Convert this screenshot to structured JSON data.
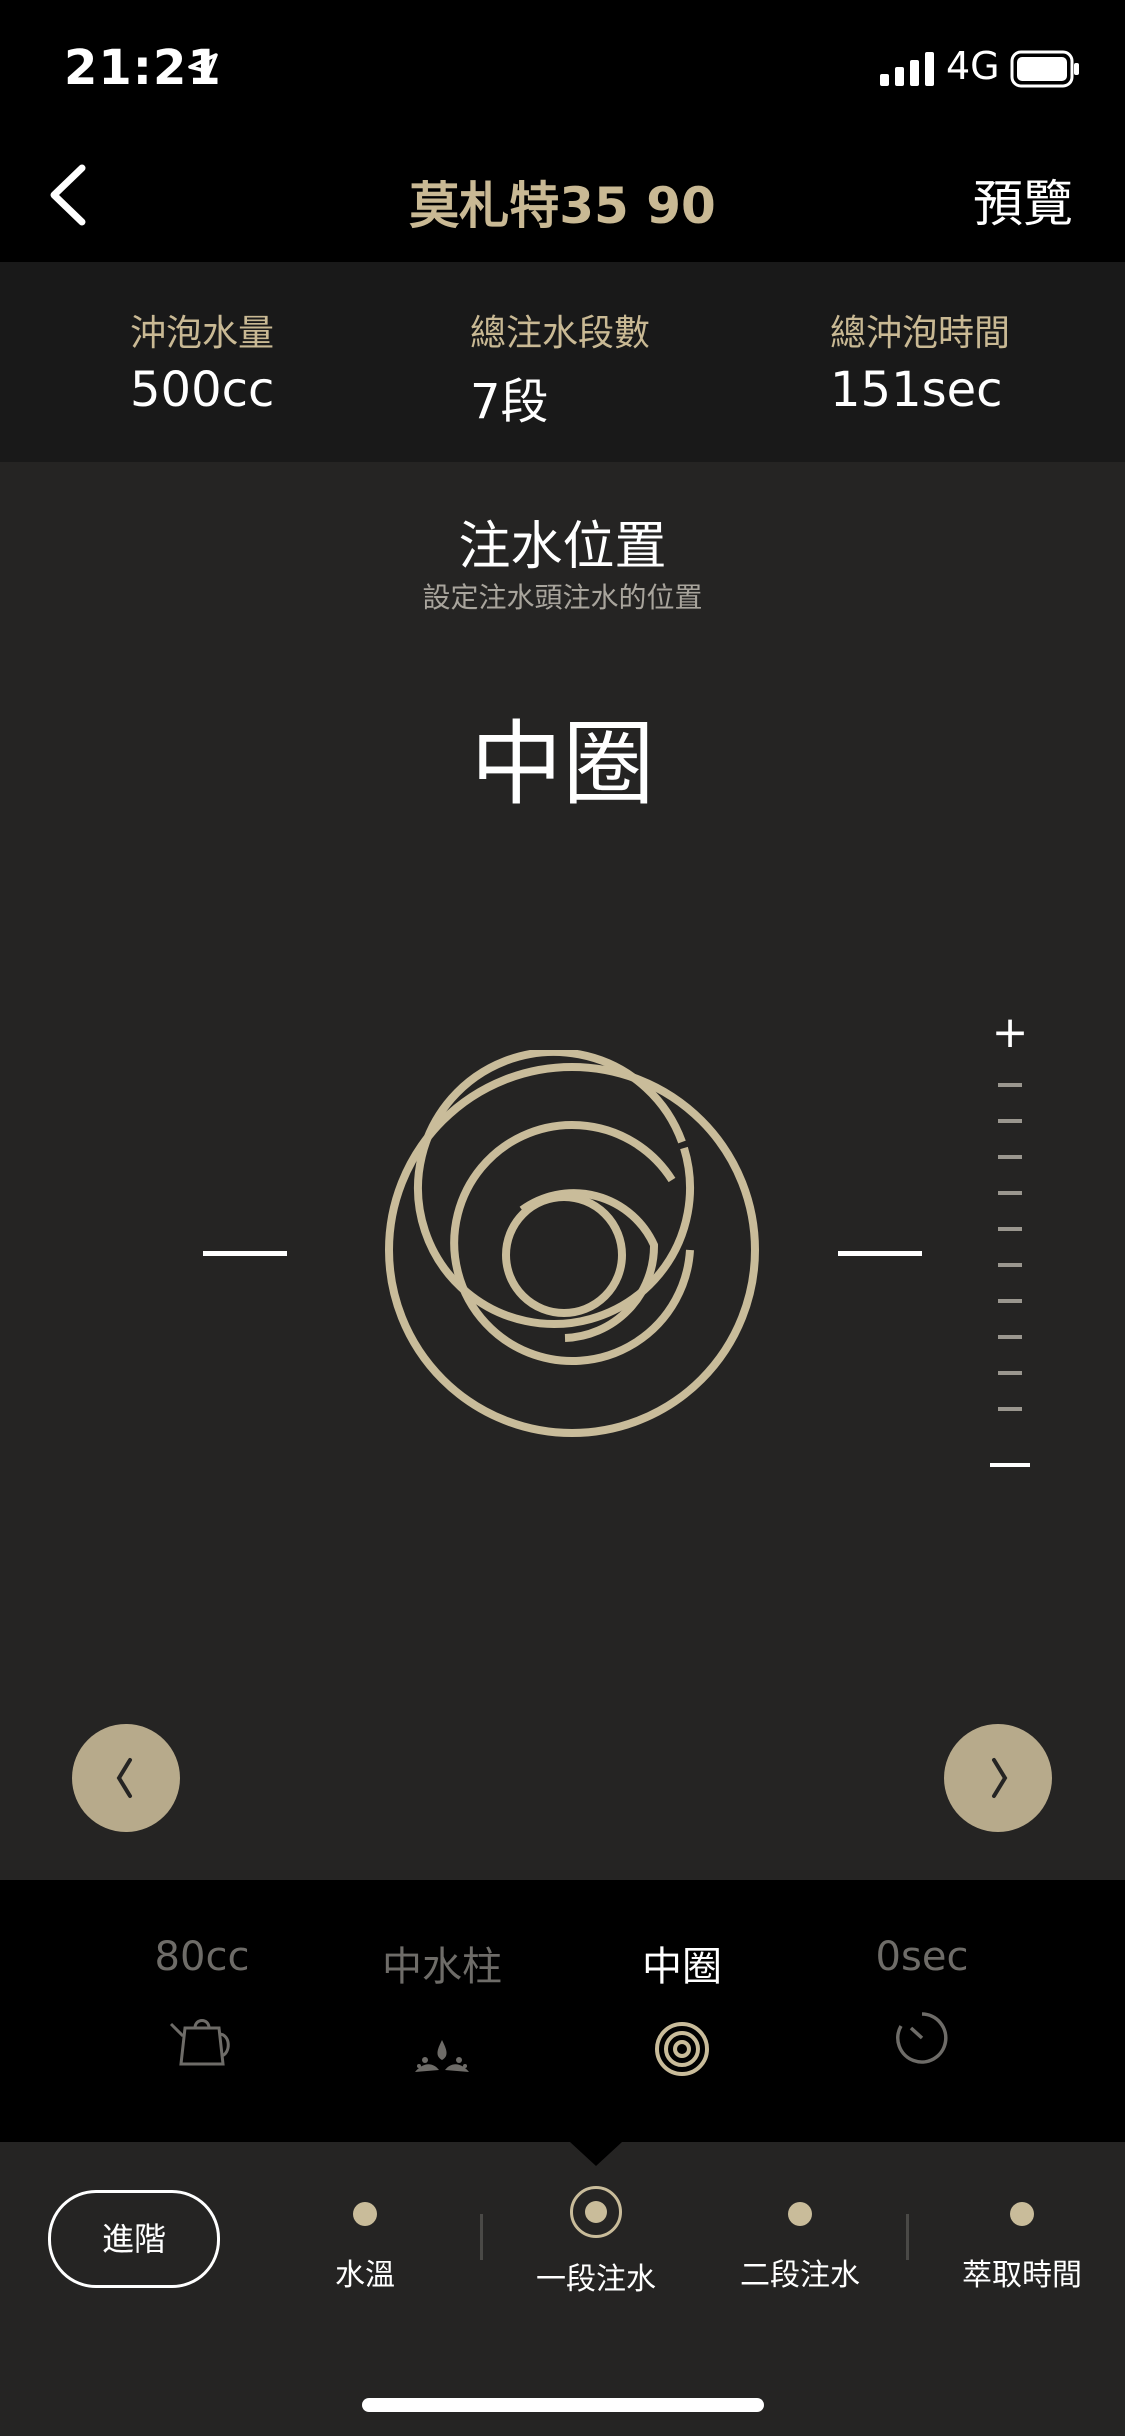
{
  "status_bar": {
    "time": "21:21",
    "network": "4G"
  },
  "nav": {
    "title": "莫札特35 90",
    "preview_label": "預覽"
  },
  "summary": [
    {
      "label": "沖泡水量",
      "value": "500cc"
    },
    {
      "label": "總注水段數",
      "value": "7段"
    },
    {
      "label": "總沖泡時間",
      "value": "151sec"
    }
  ],
  "section": {
    "title": "注水位置",
    "subtitle": "設定注水頭注水的位置",
    "current_value": "中圈"
  },
  "scale": {
    "plus_label": "+"
  },
  "pour_strip": [
    {
      "text": "80cc",
      "icon": "kettle-icon"
    },
    {
      "text": "中水柱",
      "icon": "water-column-icon"
    },
    {
      "text": "中圈",
      "icon": "spiral-icon"
    },
    {
      "text": "0sec",
      "icon": "timer-icon"
    }
  ],
  "bottom": {
    "advanced_label": "進階",
    "steps": [
      {
        "label": "水溫"
      },
      {
        "label": "一段注水"
      },
      {
        "label": "二段注水"
      },
      {
        "label": "萃取時間"
      }
    ]
  },
  "colors": {
    "accent": "#c9b994",
    "background": "#252423"
  }
}
